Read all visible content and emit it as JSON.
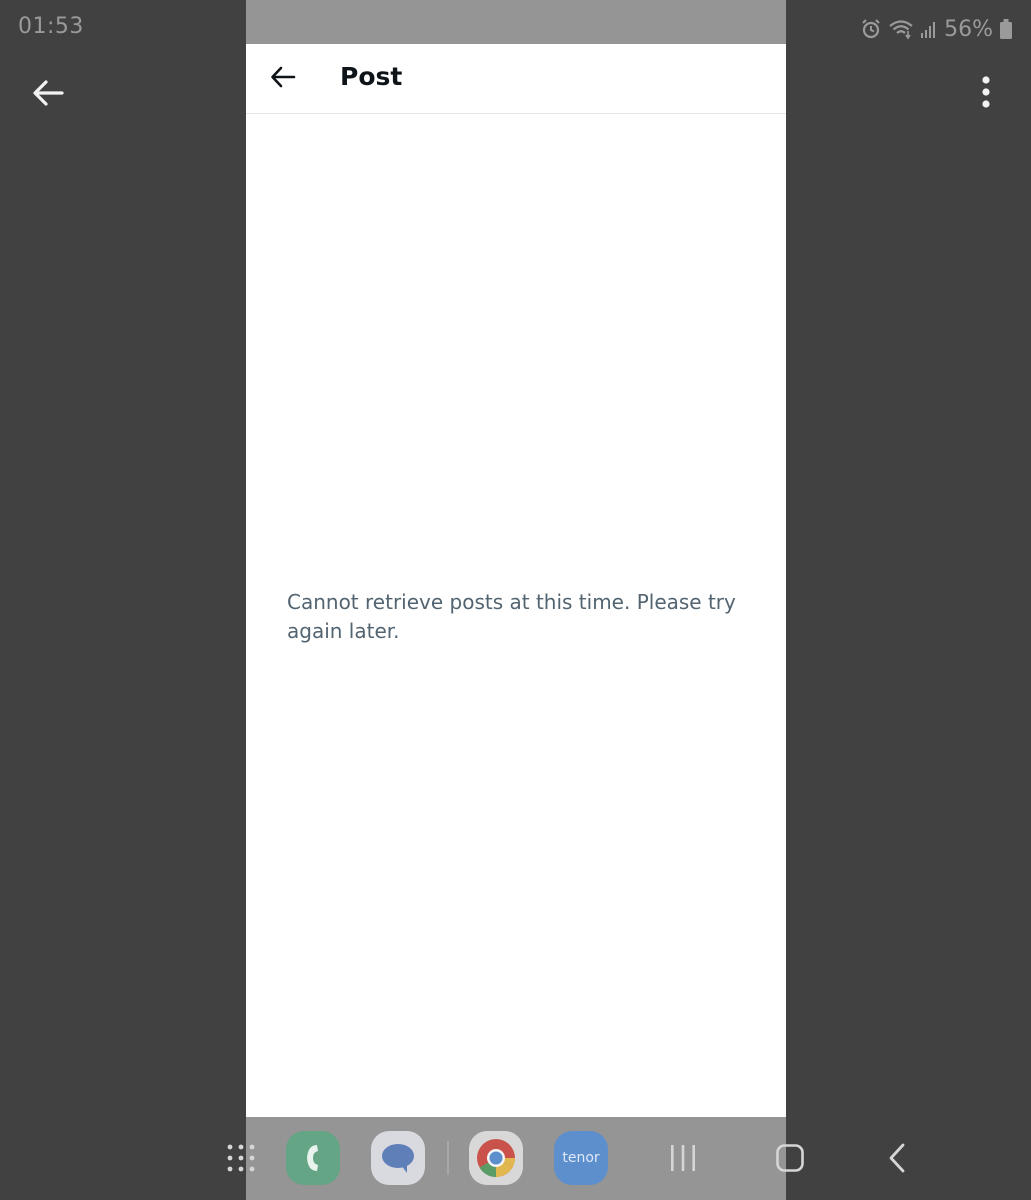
{
  "status_bar": {
    "time": "01:53",
    "battery_percent": "56%",
    "icons": [
      "alarm-icon",
      "wifi-icon",
      "signal-icon",
      "battery-icon"
    ]
  },
  "viewer": {
    "back_icon": "arrow-left-icon",
    "menu_icon": "more-vertical-icon"
  },
  "app": {
    "header_title": "Post",
    "back_icon": "arrow-left-icon",
    "error_message": "Cannot retrieve posts at this time. Please try again later."
  },
  "dock": {
    "apps": [
      "phone-app",
      "messages-app",
      "chrome-app",
      "tenor-app"
    ],
    "tenor_label": "tenor",
    "nav": [
      "recents-icon",
      "home-icon",
      "back-icon"
    ]
  },
  "colors": {
    "viewer_background": "#414141",
    "title_text": "#0f1419",
    "message_text": "#536471",
    "phone_status_bar": "#959595"
  }
}
